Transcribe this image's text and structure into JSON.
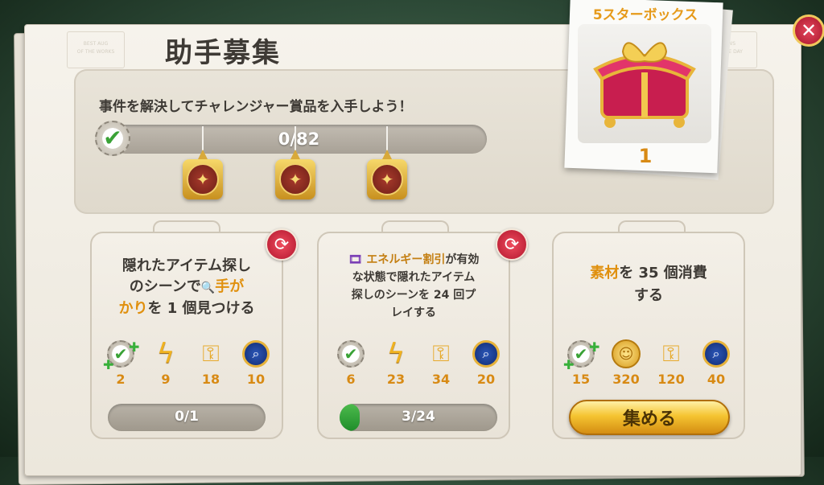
{
  "window": {
    "title": "助手募集"
  },
  "header": {
    "subtitle": "事件を解決してチャレンジャー賞品を入手しよう！"
  },
  "progress": {
    "current": 0,
    "total": 82,
    "text": "0/82"
  },
  "milestones": [
    {
      "icon": "compass-star-icon"
    },
    {
      "icon": "compass-star-icon"
    },
    {
      "icon": "compass-star-icon"
    }
  ],
  "reward": {
    "title": "5スターボックス",
    "count": "1",
    "icon": "treasure-chest-icon"
  },
  "colors": {
    "accent": "#e0900e",
    "refresh": "#d1263d",
    "progress_fill": "#2e9e34",
    "button": "#f5c431"
  },
  "tasks": [
    {
      "line1": "隠れたアイテム探し",
      "line2_a": "のシーンで",
      "line2_icon": "🔍",
      "line2_hl": "手が",
      "line3_hl": "かり",
      "line3_b": "を 1 個見つける",
      "rewards": [
        {
          "icon": "check-badge-plus-icon",
          "value": "2"
        },
        {
          "icon": "energy-bolt-icon",
          "value": "9"
        },
        {
          "icon": "wind-up-key-icon",
          "value": "18"
        },
        {
          "icon": "magnifier-medal-icon",
          "value": "10"
        }
      ],
      "progress": {
        "current": 0,
        "total": 1,
        "text": "0/1"
      }
    },
    {
      "line1_icon": "🎞",
      "line1_hl": "エネルギー割引",
      "line1_b": "が有効",
      "line2": "な状態で隠れたアイテム",
      "line3": "探しのシーンを 24 回プ",
      "line4": "レイする",
      "rewards": [
        {
          "icon": "check-badge-icon",
          "value": "6"
        },
        {
          "icon": "energy-bolt-icon",
          "value": "23"
        },
        {
          "icon": "wind-up-key-icon",
          "value": "34"
        },
        {
          "icon": "magnifier-medal-icon",
          "value": "20"
        }
      ],
      "progress": {
        "current": 3,
        "total": 24,
        "text": "3/24"
      }
    },
    {
      "line1_hl": "素材",
      "line1_b": "を 35 個消費",
      "line2": "する",
      "rewards": [
        {
          "icon": "check-badge-plus-icon",
          "value": "15"
        },
        {
          "icon": "gold-coin-icon",
          "value": "320"
        },
        {
          "icon": "wind-up-key-icon",
          "value": "120"
        },
        {
          "icon": "magnifier-medal-icon",
          "value": "40"
        }
      ],
      "collect_label": "集める"
    }
  ]
}
